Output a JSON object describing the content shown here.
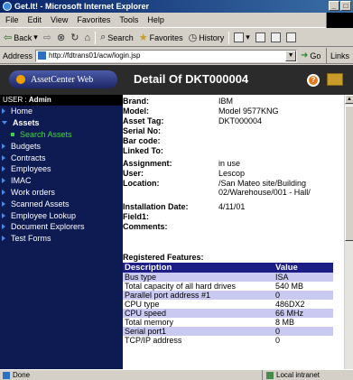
{
  "window": {
    "title": "Get.It! - Microsoft Internet Explorer"
  },
  "menu": [
    "File",
    "Edit",
    "View",
    "Favorites",
    "Tools",
    "Help"
  ],
  "toolbar": {
    "back": "Back",
    "search": "Search",
    "favorites": "Favorites",
    "history": "History"
  },
  "address": {
    "label": "Address",
    "url": "http://fdtrans01/acw/login.jsp",
    "go": "Go",
    "links": "Links"
  },
  "app": {
    "logo": "AssetCenter Web",
    "page_title": "Detail Of DKT000004"
  },
  "user": {
    "prefix": "USER : ",
    "name": "Admin"
  },
  "sidebar": {
    "items": [
      {
        "label": "Home"
      },
      {
        "label": "Assets"
      },
      {
        "label": "Search Assets"
      },
      {
        "label": "Budgets"
      },
      {
        "label": "Contracts"
      },
      {
        "label": "Employees"
      },
      {
        "label": "IMAC"
      },
      {
        "label": "Work orders"
      },
      {
        "label": "Scanned Assets"
      },
      {
        "label": "Employee Lookup"
      },
      {
        "label": "Document Explorers"
      },
      {
        "label": "Test Forms"
      }
    ]
  },
  "detail": [
    {
      "label": "Brand:",
      "value": "IBM"
    },
    {
      "label": "Model:",
      "value": "Model 9577KNG"
    },
    {
      "label": "Asset Tag:",
      "value": "DKT000004"
    },
    {
      "label": "Serial No:",
      "value": ""
    },
    {
      "label": "Bar code:",
      "value": ""
    },
    {
      "label": "Linked To:",
      "value": ""
    },
    {
      "label": "Assignment:",
      "value": "in use"
    },
    {
      "label": "User:",
      "value": "Lescop"
    },
    {
      "label": "Location:",
      "value": "/San Mateo site/Building 02/Warehouse/001 - Hall/"
    },
    {
      "label": "Installation Date:",
      "value": "4/11/01"
    },
    {
      "label": "Field1:",
      "value": ""
    },
    {
      "label": "Comments:",
      "value": ""
    }
  ],
  "features": {
    "title": "Registered Features:",
    "headers": [
      "Description",
      "Value"
    ],
    "rows": [
      {
        "desc": "Bus type",
        "value": "ISA"
      },
      {
        "desc": "Total capacity of all hard drives",
        "value": "540 MB"
      },
      {
        "desc": "Parallel port address #1",
        "value": "0"
      },
      {
        "desc": "CPU type",
        "value": "486DX2"
      },
      {
        "desc": "CPU speed",
        "value": "66 MHz"
      },
      {
        "desc": "Total memory",
        "value": "8 MB"
      },
      {
        "desc": "Serial port1",
        "value": "0"
      },
      {
        "desc": "TCP/IP address",
        "value": "0"
      }
    ]
  },
  "status": {
    "left": "Done",
    "zone": "Local intranet"
  }
}
